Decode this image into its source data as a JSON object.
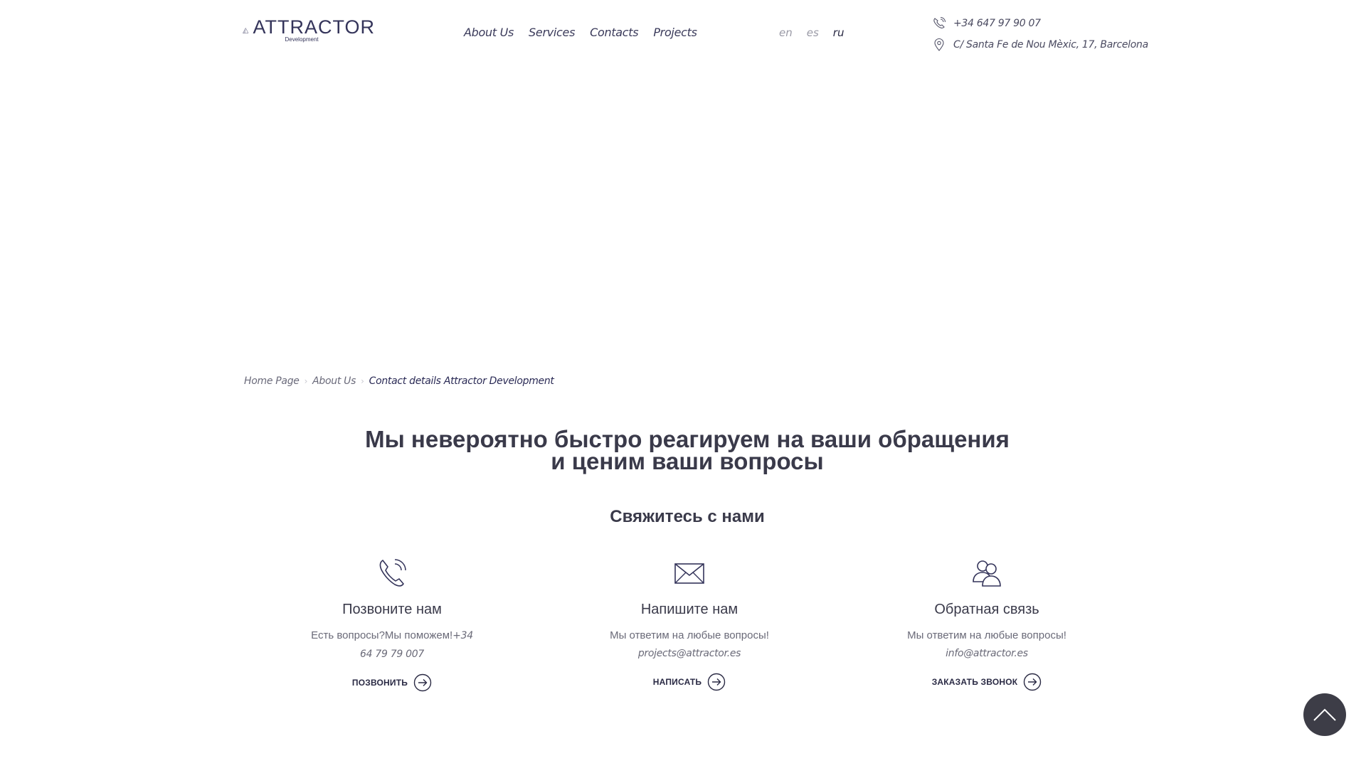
{
  "header": {
    "logo_title": "ATTRACTOR",
    "logo_subtitle": "Development",
    "nav": [
      {
        "label": "About Us"
      },
      {
        "label": "Services"
      },
      {
        "label": "Contacts"
      },
      {
        "label": "Projects"
      }
    ],
    "languages": [
      {
        "label": "en",
        "active": false
      },
      {
        "label": "es",
        "active": false
      },
      {
        "label": "ru",
        "active": true
      }
    ],
    "phone": "+34 647 97 90 07",
    "address": "C/ Santa Fe de Nou Mèxic, 17, Barcelona"
  },
  "breadcrumb": {
    "home": "Home Page",
    "about": "About Us",
    "current": "Contact details Attractor Development"
  },
  "main": {
    "headline_line1": "Мы невероятно быстро реагируем на ваши обращения",
    "headline_line2": "и ценим ваши вопросы",
    "subheadline": "Свяжитесь с нами",
    "cards": [
      {
        "icon": "phone-icon",
        "title": "Позвоните нам",
        "desc_text": "Есть вопросы?Мы поможем!",
        "desc_value_a": "+34",
        "desc_value_b": "64 79 79 007",
        "action": "ПОЗВОНИТЬ"
      },
      {
        "icon": "envelope-icon",
        "title": "Напишите нам",
        "desc_text": "Мы ответим на любые вопросы!",
        "desc_value": "projects@attractor.es",
        "action": "НАПИСАТЬ"
      },
      {
        "icon": "users-icon",
        "title": "Обратная связь",
        "desc_text": "Мы ответим на любые вопросы!",
        "desc_value": "info@attractor.es",
        "action": "ЗАКАЗАТЬ ЗВОНОК"
      }
    ]
  },
  "colors": {
    "text_dark": "#3a3a4a",
    "brand": "#34345a",
    "scroll_button": "#3d3d47"
  }
}
